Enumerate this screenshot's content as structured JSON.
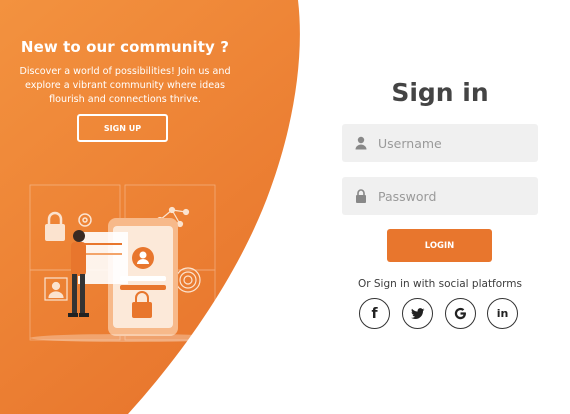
{
  "promo": {
    "title": "New to our community ?",
    "description": "Discover a world of possibilities! Join us and explore a vibrant community where ideas flourish and connections thrive.",
    "signup_label": "SIGN UP"
  },
  "signin": {
    "title": "Sign in",
    "username_placeholder": "Username",
    "password_placeholder": "Password",
    "login_label": "LOGIN",
    "social_text": "Or Sign in with social platforms",
    "social": [
      {
        "name": "facebook",
        "glyph": "f"
      },
      {
        "name": "twitter",
        "glyph": ""
      },
      {
        "name": "google",
        "glyph": ""
      },
      {
        "name": "linkedin",
        "glyph": "in"
      }
    ]
  },
  "colors": {
    "accent": "#e8762d",
    "accent_light": "#f08f3e",
    "field_bg": "#f0f0f0",
    "title_text": "#444444"
  },
  "icons": {
    "username": "user-icon",
    "password": "lock-icon",
    "social": [
      "facebook-icon",
      "twitter-icon",
      "google-icon",
      "linkedin-icon"
    ]
  }
}
